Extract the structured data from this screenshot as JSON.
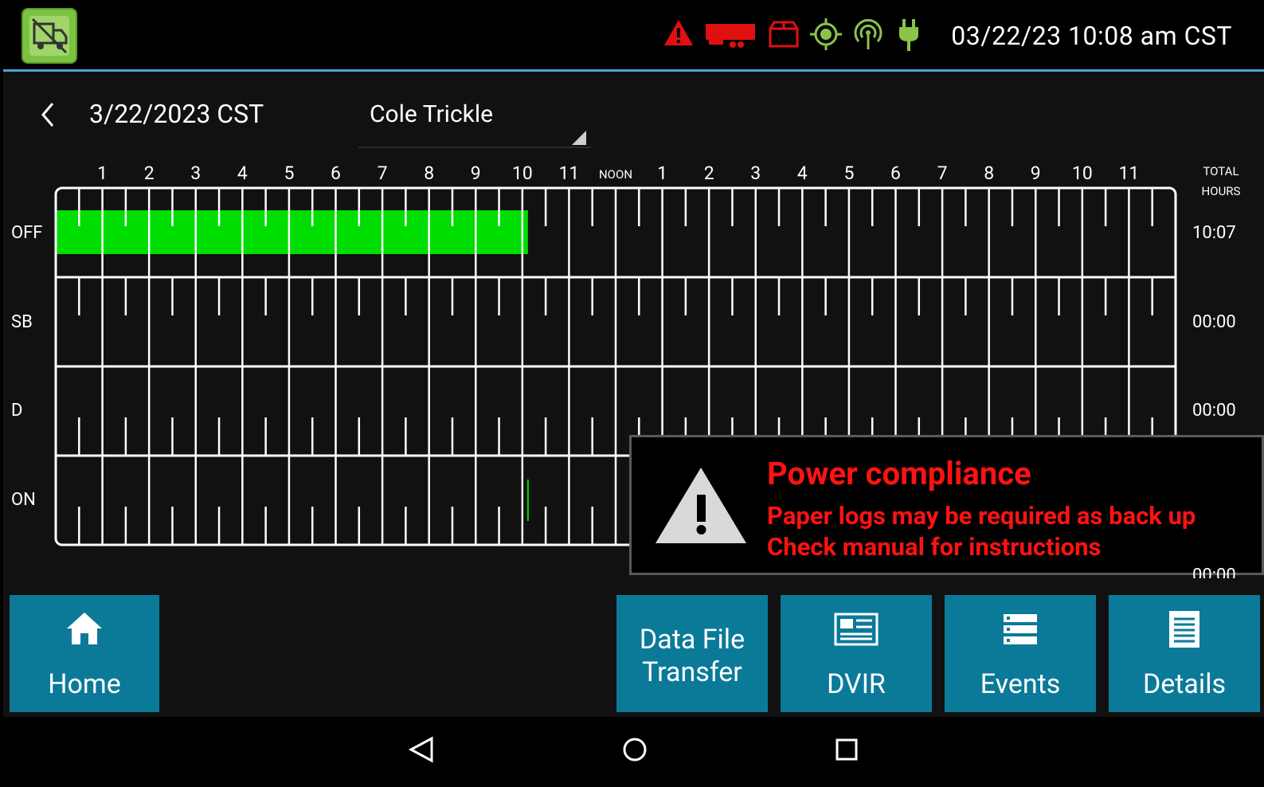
{
  "status_bar": {
    "datetime": "03/22/23 10:08 am CST",
    "icons": [
      "warning-icon",
      "trailer-icon",
      "package-icon",
      "gps-icon",
      "cellular-icon",
      "power-plug-icon"
    ],
    "colors": {
      "warning": "#e01010",
      "ok": "#8bc34a"
    }
  },
  "header": {
    "log_date": "3/22/2023 CST",
    "driver_name": "Cole Trickle"
  },
  "grid": {
    "hours": [
      "1",
      "2",
      "3",
      "4",
      "5",
      "6",
      "7",
      "8",
      "9",
      "10",
      "11",
      "NOON",
      "1",
      "2",
      "3",
      "4",
      "5",
      "6",
      "7",
      "8",
      "9",
      "10",
      "11"
    ],
    "total_header": [
      "TOTAL",
      "HOURS"
    ],
    "rows": [
      {
        "label": "OFF",
        "total": "10:07"
      },
      {
        "label": "SB",
        "total": "00:00"
      },
      {
        "label": "D",
        "total": "00:00"
      },
      {
        "label": "ON",
        "total": "00:00"
      }
    ],
    "duty_segments": [
      {
        "status": "OFF",
        "start_hour": 0,
        "end_hour": 10.12
      }
    ],
    "current_time_hour": 10.12,
    "colors": {
      "duty_line": "#00dd00",
      "grid": "#ffffff"
    }
  },
  "alert": {
    "title": "Power compliance",
    "line1": "Paper logs may be required as back up",
    "line2": "Check manual for instructions",
    "color": "#ff1212"
  },
  "nav": {
    "home": "Home",
    "data_file_transfer_1": "Data File",
    "data_file_transfer_2": "Transfer",
    "dvir": "DVIR",
    "events": "Events",
    "details": "Details",
    "color": "#0b7a99"
  },
  "android_nav": [
    "back-icon",
    "home-circle-icon",
    "recents-icon"
  ]
}
